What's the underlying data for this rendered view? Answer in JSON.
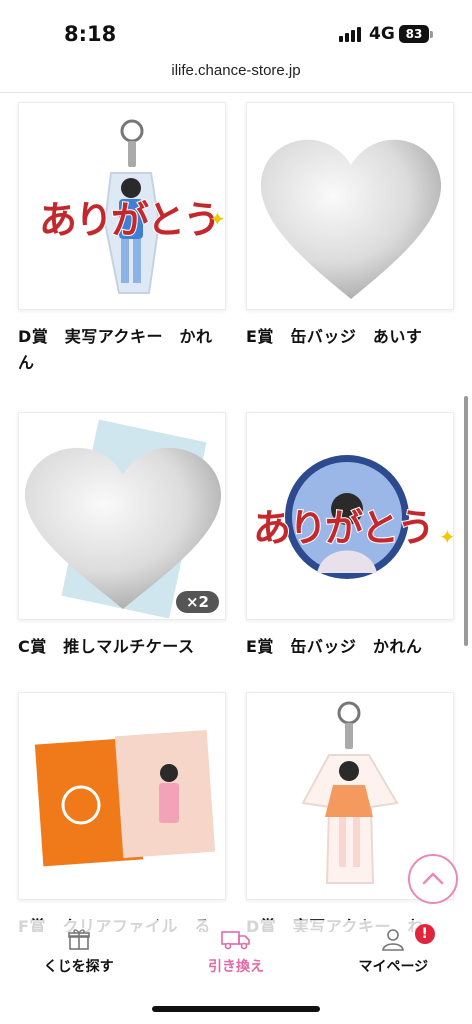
{
  "status_bar": {
    "time": "8:18",
    "network": "4G",
    "battery": "83"
  },
  "browser": {
    "url": "ilife.chance-store.jp"
  },
  "products": [
    {
      "caption": "D賞　実写アクキー　かれん",
      "image": "acrylic-keychain",
      "overlay_text": "ありがとう"
    },
    {
      "caption": "E賞　缶バッジ　あいす",
      "image": "heart-placeholder"
    },
    {
      "caption": "C賞　推しマルチケース",
      "image": "heart-placeholder",
      "quantity": "×2"
    },
    {
      "caption": "E賞　缶バッジ　かれん",
      "image": "can-badge",
      "overlay_text": "ありがとう"
    },
    {
      "caption": "F賞　クリアファイル　る",
      "image": "clear-file"
    },
    {
      "caption": "D賞　実写アクキー　ね",
      "image": "acrylic-keychain"
    }
  ],
  "tabbar": {
    "items": [
      {
        "label": "くじを探す",
        "icon": "gift-icon",
        "active": false
      },
      {
        "label": "引き換え",
        "icon": "truck-icon",
        "active": true
      },
      {
        "label": "マイページ",
        "icon": "user-icon",
        "active": false,
        "badge": "!"
      }
    ]
  },
  "colors": {
    "accent_pink": "#e889b8",
    "active_tab": "#e26aa6",
    "badge_red": "#e0243a",
    "text_red": "#c4282c",
    "file_orange": "#f07a1a"
  }
}
